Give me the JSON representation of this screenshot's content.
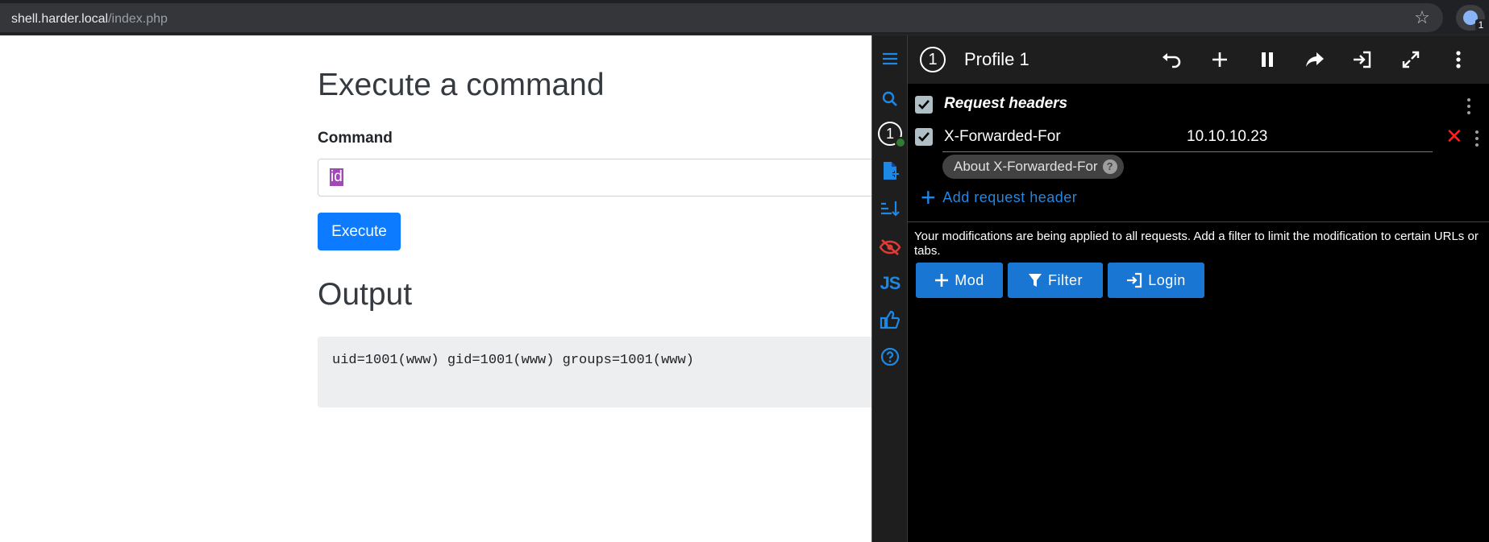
{
  "browser": {
    "url_host": "shell.harder.local",
    "url_path": "/index.php",
    "extension_badge": "1"
  },
  "page": {
    "heading": "Execute a command",
    "command_label": "Command",
    "command_value": "id",
    "execute_label": "Execute",
    "output_heading": "Output",
    "output_text": "uid=1001(www) gid=1001(www) groups=1001(www)"
  },
  "panel": {
    "profile_number": "1",
    "profile_name": "Profile 1",
    "sidebar_profile_number": "1",
    "sidebar_js_label": "JS",
    "section_title": "Request headers",
    "header": {
      "name": "X-Forwarded-For",
      "value": "10.10.10.23"
    },
    "about_chip": "About X-Forwarded-For",
    "about_help": "?",
    "add_header_label": "Add request header",
    "notice": "Your modifications are being applied to all requests. Add a filter to limit the modification to certain URLs or tabs.",
    "buttons": {
      "mod": "Mod",
      "filter": "Filter",
      "login": "Login"
    },
    "accent_color": "#1e88e5",
    "danger_color": "#ff1f1f"
  }
}
